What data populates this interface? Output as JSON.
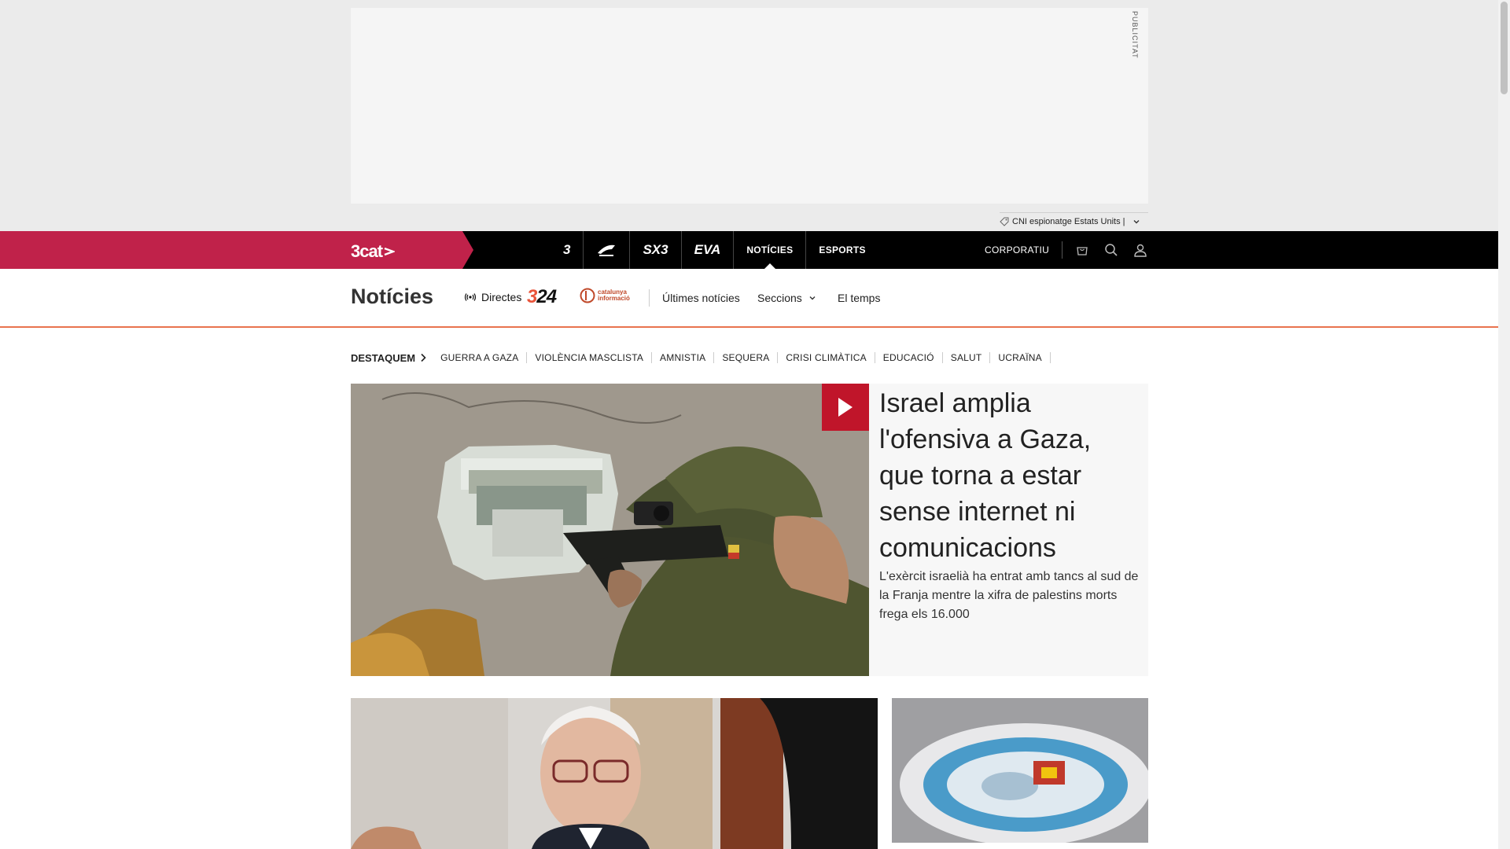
{
  "ad": {
    "label": "PUBLICITAT",
    "tag_text": "CNI espionatge Estats Units |"
  },
  "topnav": {
    "brand": "3cat",
    "channels": [
      {
        "label": "3",
        "icon": "tv3-logo"
      },
      {
        "label": "Cat Ràdio",
        "icon": "catradio-logo"
      },
      {
        "label": "SX3",
        "icon": "sx3-logo"
      },
      {
        "label": "EVA",
        "icon": "eva-logo"
      },
      {
        "label": "NOTÍCIES",
        "active": true
      },
      {
        "label": "ESPORTS"
      }
    ],
    "corporate": "CORPORATIU",
    "icons": [
      "shopping-bag-icon",
      "search-icon",
      "user-icon"
    ]
  },
  "section": {
    "title": "Notícies",
    "live": "Directes",
    "logo_324_a": "3",
    "logo_324_b": "24",
    "logo_ci": "catalunya informació",
    "links": [
      "Últimes notícies",
      "Seccions",
      "El temps"
    ]
  },
  "highlights": {
    "lead": "DESTAQUEM",
    "items": [
      "GUERRA A GAZA",
      "VIOLÈNCIA MASCLISTA",
      "AMNISTIA",
      "SEQUERA",
      "CRISI CLIMÀTICA",
      "EDUCACIÓ",
      "SALUT",
      "UCRAÏNA"
    ]
  },
  "hero": {
    "headline": "Israel amplia l'ofensiva a Gaza, que torna a estar sense internet ni comunicacions",
    "summary": "L'exèrcit israelià ha entrat amb tancs al sud de la Franja mentre la xifra de palestins morts frega els 16.000"
  },
  "colors": {
    "brand": "#c0224a",
    "accent_line": "#e9734e",
    "play": "#c0152a"
  }
}
